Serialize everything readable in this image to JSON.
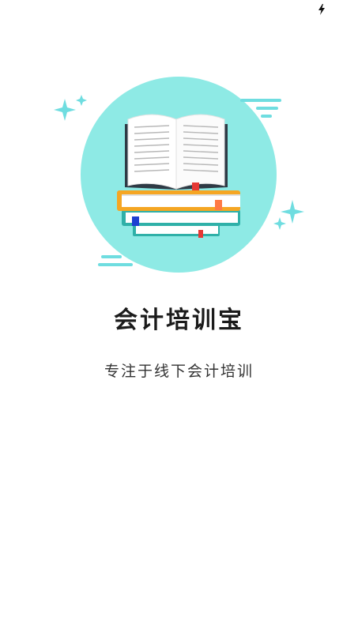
{
  "status_bar": {
    "icons": [
      "charging-bolt-icon"
    ]
  },
  "splash": {
    "illustration": "stack-of-books-with-open-book-icon",
    "title": "会计培训宝",
    "tagline": "专注于线下会计培训"
  },
  "colors": {
    "circle": "#8eeae5",
    "sparkle": "#6fdde0",
    "book_orange": "#f5a623",
    "book_teal": "#2fb0a8",
    "title": "#1b1b1b",
    "tagline": "#333333"
  }
}
